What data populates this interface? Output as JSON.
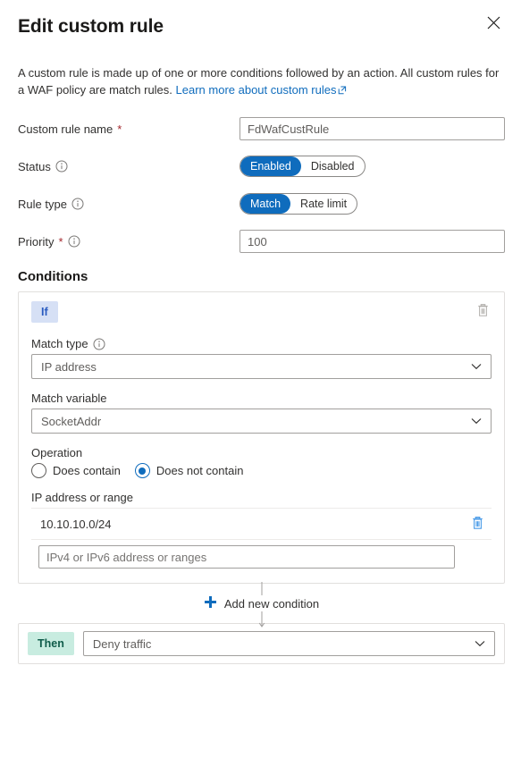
{
  "header": {
    "title": "Edit custom rule",
    "close_icon": "close-icon"
  },
  "description": {
    "text_before": "A custom rule is made up of one or more conditions followed by an action. All custom rules for a WAF policy are match rules.",
    "link_text": "Learn more about custom rules",
    "link_icon": "external-link-icon"
  },
  "form": {
    "custom_rule_name": {
      "label": "Custom rule name",
      "required_marker": "*",
      "value": "FdWafCustRule",
      "placeholder": ""
    },
    "status": {
      "label": "Status",
      "info_icon": "info-icon",
      "options": [
        "Enabled",
        "Disabled"
      ],
      "selected": "Enabled"
    },
    "rule_type": {
      "label": "Rule type",
      "info_icon": "info-icon",
      "options": [
        "Match",
        "Rate limit"
      ],
      "selected": "Match"
    },
    "priority": {
      "label": "Priority",
      "required_marker": "*",
      "info_icon": "info-icon",
      "value": "100",
      "placeholder": ""
    }
  },
  "conditions": {
    "section_title": "Conditions",
    "card": {
      "badge": "If",
      "delete_icon": "trash-icon",
      "match_type": {
        "label": "Match type",
        "info_icon": "info-icon",
        "value": "IP address",
        "chevron": "chevron-down-icon"
      },
      "match_variable": {
        "label": "Match variable",
        "value": "SocketAddr",
        "chevron": "chevron-down-icon"
      },
      "operation": {
        "label": "Operation",
        "options": [
          "Does contain",
          "Does not contain"
        ],
        "selected": "Does not contain"
      },
      "ip_address": {
        "label": "IP address or range",
        "entries": [
          "10.10.10.0/24"
        ],
        "entry_delete_icon": "trash-icon",
        "input_placeholder": "IPv4 or IPv6 address or ranges",
        "input_value": ""
      }
    },
    "add_condition": {
      "label": "Add new condition",
      "icon": "plus-icon"
    }
  },
  "action": {
    "badge": "Then",
    "value": "Deny traffic",
    "chevron": "chevron-down-icon"
  },
  "colors": {
    "accent_blue": "#0f6cbd",
    "link_blue": "#0f6cbd",
    "if_badge_bg": "#d6e0f5",
    "if_badge_fg": "#2a5bbf",
    "then_badge_bg": "#c8ece0",
    "then_badge_fg": "#0f5c4a",
    "required_red": "#a4262c",
    "trash_blue": "#4a9be8",
    "trash_gray": "#b3b0ad"
  }
}
